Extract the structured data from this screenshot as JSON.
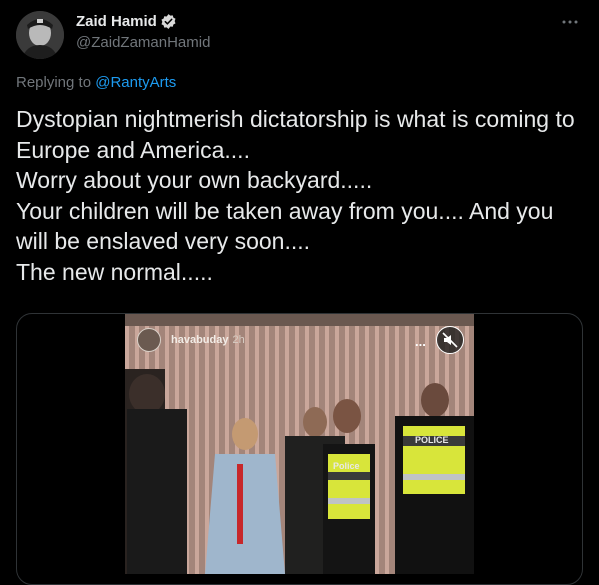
{
  "author": {
    "display_name": "Zaid Hamid",
    "handle": "@ZaidZamanHamid",
    "verified_icon": "verified-badge-icon",
    "avatar_icon": "avatar"
  },
  "reply": {
    "prefix": "Replying to ",
    "target": "@RantyArts"
  },
  "tweet": {
    "lines": [
      "Dystopian nightmerish dictatorship is what is coming to Europe and America....",
      "Worry about your own backyard.....",
      "Your children will be taken away from you.... And you will be enslaved very soon....",
      "",
      "The new normal....."
    ]
  },
  "media": {
    "story_username": "havabuday",
    "story_time": "2h",
    "story_menu": "...",
    "vest_label_1": "POLICE",
    "vest_label_2": "Police"
  },
  "colors": {
    "background": "#000000",
    "text": "#e7e9ea",
    "muted": "#71767b",
    "link": "#1d9bf0",
    "border": "#2f3336"
  }
}
